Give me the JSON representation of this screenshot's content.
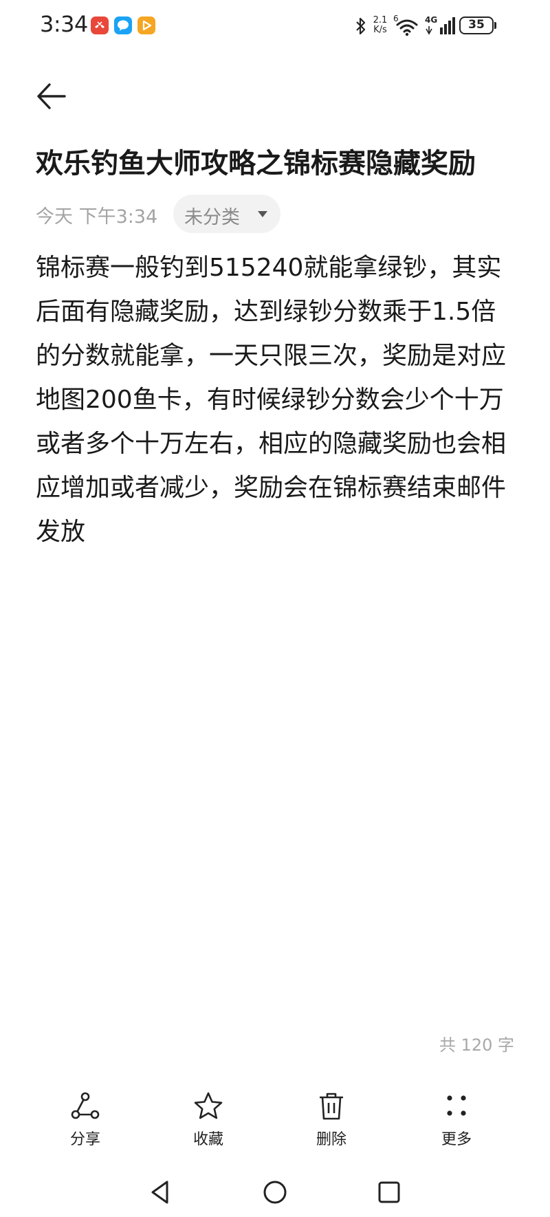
{
  "status_bar": {
    "time": "3:34",
    "net_speed_value": "2.1",
    "net_speed_unit": "K/s",
    "wifi_label": "6",
    "cell_label": "4G",
    "battery": "35",
    "notification_colors": [
      "#e8473a",
      "#1aa3f5",
      "#f5a623"
    ]
  },
  "note": {
    "title": "欢乐钓鱼大师攻略之锦标赛隐藏奖励",
    "date": "今天 下午3:34",
    "category": "未分类",
    "body": "锦标赛一般钓到515240就能拿绿钞，其实后面有隐藏奖励，达到绿钞分数乘于1.5倍的分数就能拿，一天只限三次，奖励是对应地图200鱼卡，有时候绿钞分数会少个十万或者多个十万左右，相应的隐藏奖励也会相应增加或者减少，奖励会在锦标赛结束邮件发放",
    "word_count": "共 120 字"
  },
  "toolbar": {
    "share_label": "分享",
    "favorite_label": "收藏",
    "delete_label": "删除",
    "more_label": "更多"
  },
  "icons": {
    "back": "arrow-left-icon",
    "share": "share-icon",
    "favorite": "star-icon",
    "delete": "trash-icon",
    "more": "dots-grid-icon",
    "nav_back": "triangle-back-icon",
    "nav_home": "circle-home-icon",
    "nav_recent": "square-recent-icon"
  }
}
